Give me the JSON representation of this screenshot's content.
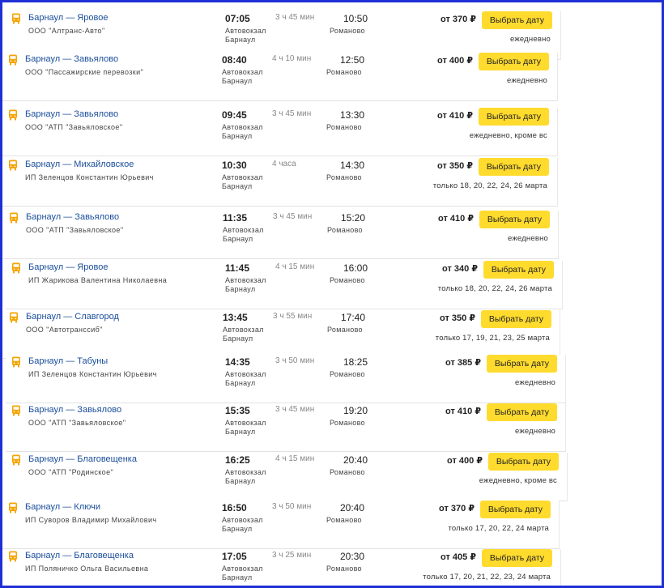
{
  "currency": "₽",
  "price_prefix": "от",
  "button_label": "Выбрать дату",
  "dep_station": "Автовокзал Барнаул",
  "arr_station": "Романово",
  "trips": [
    {
      "route": "Барнаул — Яровое",
      "carrier": "ООО \"Алтранс-Авто\"",
      "dep": "07:05",
      "duration": "3 ч 45 мин",
      "arr": "10:50",
      "price": "от 370 ₽",
      "schedule": "ежедневно"
    },
    {
      "route": "Барнаул — Завьялово",
      "carrier": "ООО \"Пассажирские перевозки\"",
      "dep": "08:40",
      "duration": "4 ч 10 мин",
      "arr": "12:50",
      "price": "от 400 ₽",
      "schedule": "ежедневно"
    },
    {
      "route": "Барнаул — Завьялово",
      "carrier": "ООО \"АТП \"Завьяловское\"",
      "dep": "09:45",
      "duration": "3 ч 45 мин",
      "arr": "13:30",
      "price": "от 410 ₽",
      "schedule": "ежедневно, кроме вс"
    },
    {
      "route": "Барнаул — Михайловское",
      "carrier": "ИП Зеленцов Константин Юрьевич",
      "dep": "10:30",
      "duration": "4 часа",
      "arr": "14:30",
      "price": "от 350 ₽",
      "schedule": "только 18, 20, 22, 24, 26 марта"
    },
    {
      "route": "Барнаул — Завьялово",
      "carrier": "ООО \"АТП \"Завьяловское\"",
      "dep": "11:35",
      "duration": "3 ч 45 мин",
      "arr": "15:20",
      "price": "от 410 ₽",
      "schedule": "ежедневно"
    },
    {
      "route": "Барнаул — Яровое",
      "carrier": "ИП Жарикова Валентина Николаевна",
      "dep": "11:45",
      "duration": "4 ч 15 мин",
      "arr": "16:00",
      "price": "от 340 ₽",
      "schedule": "только 18, 20, 22, 24, 26 марта"
    },
    {
      "route": "Барнаул — Славгород",
      "carrier": "ООО \"Автотранссиб\"",
      "dep": "13:45",
      "duration": "3 ч 55 мин",
      "arr": "17:40",
      "price": "от 350 ₽",
      "schedule": "только 17, 19, 21, 23, 25 марта"
    },
    {
      "route": "Барнаул — Табуны",
      "carrier": "ИП Зеленцов Константин Юрьевич",
      "dep": "14:35",
      "duration": "3 ч 50 мин",
      "arr": "18:25",
      "price": "от 385 ₽",
      "schedule": "ежедневно"
    },
    {
      "route": "Барнаул — Завьялово",
      "carrier": "ООО \"АТП \"Завьяловское\"",
      "dep": "15:35",
      "duration": "3 ч 45 мин",
      "arr": "19:20",
      "price": "от 410 ₽",
      "schedule": "ежедневно"
    },
    {
      "route": "Барнаул — Благовещенка",
      "carrier": "ООО \"АТП \"Родинское\"",
      "dep": "16:25",
      "duration": "4 ч 15 мин",
      "arr": "20:40",
      "price": "от 400 ₽",
      "schedule": "ежедневно, кроме вс"
    },
    {
      "route": "Барнаул — Ключи",
      "carrier": "ИП Суворов Владимир Михайлович",
      "dep": "16:50",
      "duration": "3 ч 50 мин",
      "arr": "20:40",
      "price": "от 370 ₽",
      "schedule": "только 17, 20, 22, 24 марта"
    },
    {
      "route": "Барнаул — Благовещенка",
      "carrier": "ИП Поляничко Ольга Васильевна",
      "dep": "17:05",
      "duration": "3 ч 25 мин",
      "arr": "20:30",
      "price": "от 405 ₽",
      "schedule": "только 17, 20, 21, 22, 23, 24 марта"
    }
  ],
  "colors": {
    "frame": "#1f2fd6",
    "link": "#1a4e9a",
    "button": "#ffdb2e",
    "bus_icon": "#f5a400"
  }
}
